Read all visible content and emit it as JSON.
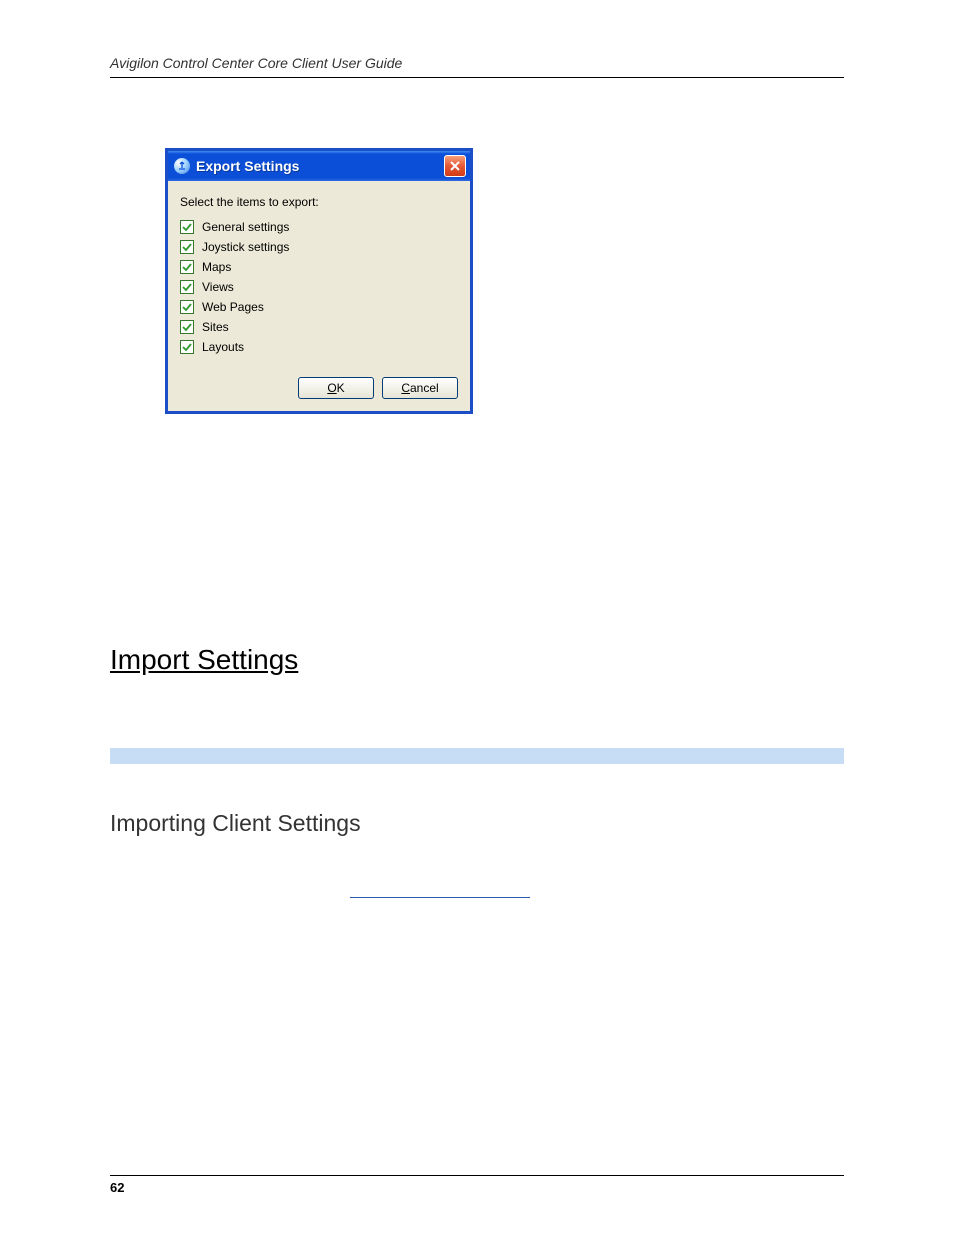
{
  "header": "Avigilon Control Center Core Client User Guide",
  "dialog": {
    "title": "Export Settings",
    "instruction": "Select the items to export:",
    "items": [
      {
        "label": "General settings",
        "checked": true
      },
      {
        "label": "Joystick settings",
        "checked": true
      },
      {
        "label": "Maps",
        "checked": true
      },
      {
        "label": "Views",
        "checked": true
      },
      {
        "label": "Web Pages",
        "checked": true
      },
      {
        "label": "Sites",
        "checked": true
      },
      {
        "label": "Layouts",
        "checked": true
      }
    ],
    "ok_u": "O",
    "ok_rest": "K",
    "cancel_u": "C",
    "cancel_rest": "ancel"
  },
  "section1": "Import Settings",
  "section2": "Importing Client Settings",
  "page_number": "62"
}
